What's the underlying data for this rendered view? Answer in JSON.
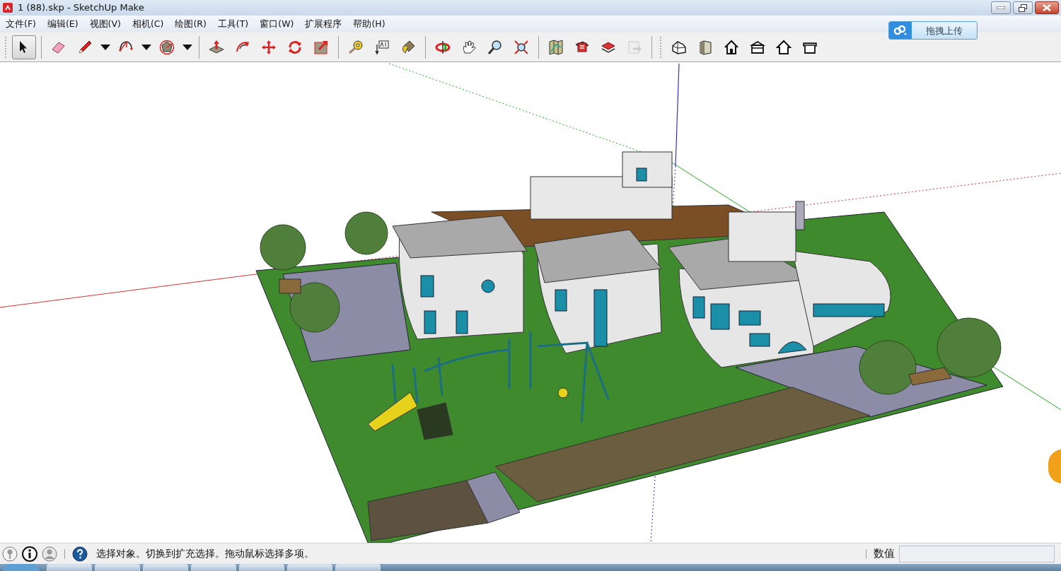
{
  "window": {
    "title": "1 (88).skp - SketchUp Make"
  },
  "menu": [
    {
      "label": "文件(F)"
    },
    {
      "label": "编辑(E)"
    },
    {
      "label": "视图(V)"
    },
    {
      "label": "相机(C)"
    },
    {
      "label": "绘图(R)"
    },
    {
      "label": "工具(T)"
    },
    {
      "label": "窗口(W)"
    },
    {
      "label": "扩展程序"
    },
    {
      "label": "帮助(H)"
    }
  ],
  "upload_button": {
    "label": "拖拽上传"
  },
  "toolbar_groups": [
    [
      {
        "kind": "tool",
        "selected": true,
        "disabled": false
      }
    ],
    [
      {
        "kind": "tool",
        "selected": false,
        "disabled": false
      },
      {
        "kind": "tool",
        "selected": false,
        "disabled": false
      },
      {
        "kind": "dropdown",
        "selected": false,
        "disabled": false
      },
      {
        "kind": "tool",
        "selected": false,
        "disabled": false
      },
      {
        "kind": "dropdown",
        "selected": false,
        "disabled": false
      },
      {
        "kind": "tool",
        "selected": false,
        "disabled": false
      },
      {
        "kind": "dropdown",
        "selected": false,
        "disabled": false
      }
    ],
    [
      {
        "kind": "tool",
        "selected": false,
        "disabled": false
      },
      {
        "kind": "tool",
        "selected": false,
        "disabled": false
      },
      {
        "kind": "tool",
        "selected": false,
        "disabled": false
      },
      {
        "kind": "tool",
        "selected": false,
        "disabled": false
      },
      {
        "kind": "tool",
        "selected": false,
        "disabled": false
      }
    ],
    [
      {
        "kind": "tool",
        "selected": false,
        "disabled": false
      },
      {
        "kind": "tool",
        "selected": false,
        "disabled": false
      },
      {
        "kind": "tool",
        "selected": false,
        "disabled": false
      }
    ],
    [
      {
        "kind": "tool",
        "selected": false,
        "disabled": false
      },
      {
        "kind": "tool",
        "selected": false,
        "disabled": false
      },
      {
        "kind": "tool",
        "selected": false,
        "disabled": false
      },
      {
        "kind": "tool",
        "selected": false,
        "disabled": false
      }
    ],
    [
      {
        "kind": "tool",
        "selected": false,
        "disabled": false
      },
      {
        "kind": "tool",
        "selected": false,
        "disabled": false
      },
      {
        "kind": "tool",
        "selected": false,
        "disabled": false
      },
      {
        "kind": "tool",
        "selected": false,
        "disabled": true
      }
    ],
    [
      {
        "kind": "tool",
        "selected": false,
        "disabled": false
      },
      {
        "kind": "tool",
        "selected": false,
        "disabled": false
      },
      {
        "kind": "tool",
        "selected": false,
        "disabled": false
      },
      {
        "kind": "tool",
        "selected": false,
        "disabled": false
      },
      {
        "kind": "tool",
        "selected": false,
        "disabled": false
      },
      {
        "kind": "tool",
        "selected": false,
        "disabled": false
      }
    ]
  ],
  "status_bar": {
    "message": "选择对象。切换到扩充选择。拖动鼠标选择多项。",
    "measurement_label": "数值"
  }
}
